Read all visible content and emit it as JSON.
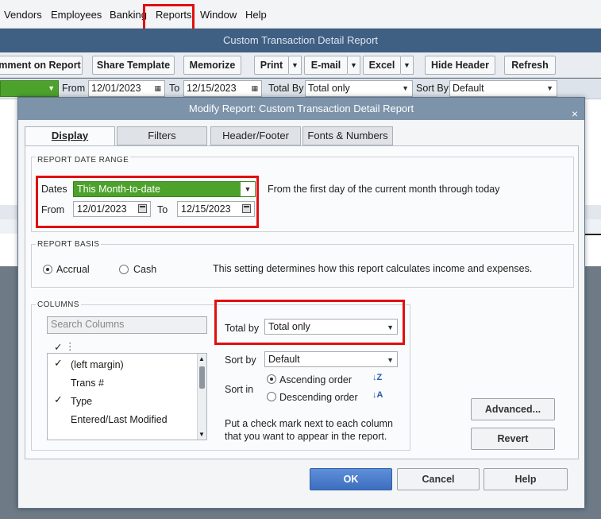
{
  "menu": {
    "items": [
      "Vendors",
      "Employees",
      "Banking",
      "Reports",
      "Window",
      "Help"
    ]
  },
  "report_window": {
    "title": "Custom Transaction Detail Report"
  },
  "toolbar": {
    "comment": "mment on Report",
    "share": "Share Template",
    "memorize": "Memorize",
    "print": "Print",
    "email": "E-mail",
    "excel": "Excel",
    "hide_header": "Hide Header",
    "refresh": "Refresh"
  },
  "filterbar": {
    "from_label": "From",
    "from_value": "12/01/2023",
    "to_label": "To",
    "to_value": "12/15/2023",
    "total_by_label": "Total By",
    "total_by_value": "Total only",
    "sort_by_label": "Sort By",
    "sort_by_value": "Default"
  },
  "dialog": {
    "title": "Modify Report: Custom Transaction Detail Report",
    "close": "×",
    "tabs": [
      "Display",
      "Filters",
      "Header/Footer",
      "Fonts & Numbers"
    ],
    "date_range": {
      "title": "REPORT DATE RANGE",
      "dates_label": "Dates",
      "dates_value": "This Month-to-date",
      "description": "From the first day of the current month through today",
      "from_label": "From",
      "from_value": "12/01/2023",
      "to_label": "To",
      "to_value": "12/15/2023"
    },
    "basis": {
      "title": "REPORT BASIS",
      "accrual": "Accrual",
      "cash": "Cash",
      "selected": "Accrual",
      "description": "This setting determines how this report calculates income and expenses."
    },
    "columns": {
      "title": "COLUMNS",
      "search_placeholder": "Search Columns",
      "header_check": "✓",
      "header_dots": "⋮",
      "items": [
        {
          "label": "(left margin)",
          "checked": true
        },
        {
          "label": "Trans #",
          "checked": false
        },
        {
          "label": "Type",
          "checked": true
        },
        {
          "label": "Entered/Last Modified",
          "checked": false
        }
      ],
      "total_by_label": "Total by",
      "total_by_value": "Total only",
      "sort_by_label": "Sort by",
      "sort_by_value": "Default",
      "sort_in_label": "Sort in",
      "ascending": "Ascending order",
      "descending": "Descending order",
      "sort_selected": "Ascending order",
      "hint_line1": "Put a check mark next to each column",
      "hint_line2": "that you want to appear in the report."
    },
    "buttons": {
      "advanced": "Advanced...",
      "revert": "Revert",
      "ok": "OK",
      "cancel": "Cancel",
      "help": "Help"
    }
  },
  "colors": {
    "highlight": "#e01010",
    "title_bar": "#3f5f83",
    "dialog_title": "#7c93aa",
    "green_field": "#4da22b"
  }
}
